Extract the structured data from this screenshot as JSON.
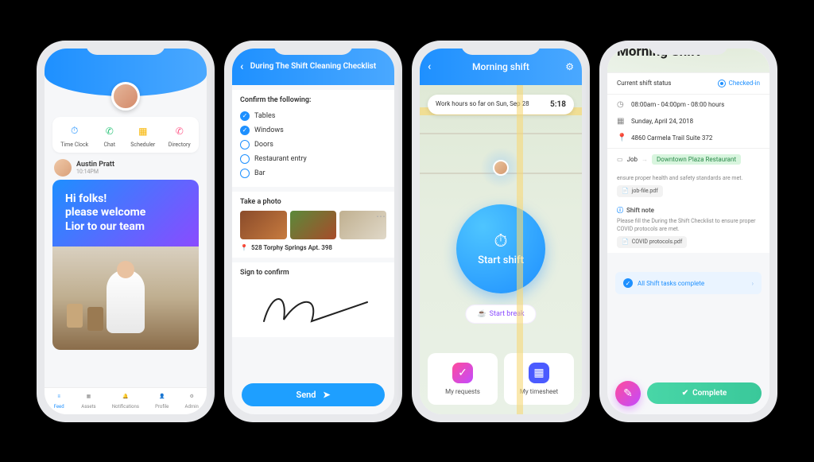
{
  "screen1": {
    "quicklinks": [
      {
        "label": "Time Clock",
        "icon": "⏱",
        "color": "#1e90ff"
      },
      {
        "label": "Chat",
        "icon": "☎",
        "color": "#2cc47a"
      },
      {
        "label": "Scheduler",
        "icon": "📅",
        "color": "#f7b500"
      },
      {
        "label": "Directory",
        "icon": "📞",
        "color": "#ff5b8a"
      }
    ],
    "post": {
      "author": "Austin Pratt",
      "time": "10:14PM",
      "welcome_line1": "Hi folks!",
      "welcome_line2": "please welcome",
      "welcome_line3": "Lior to our team"
    },
    "tabs": [
      {
        "label": "Feed",
        "active": true
      },
      {
        "label": "Assets",
        "active": false
      },
      {
        "label": "Notifications",
        "active": false
      },
      {
        "label": "Profile",
        "active": false
      },
      {
        "label": "Admin",
        "active": false
      }
    ]
  },
  "screen2": {
    "title": "During The Shift Cleaning Checklist",
    "confirm_label": "Confirm the following:",
    "items": [
      {
        "label": "Tables",
        "checked": true
      },
      {
        "label": "Windows",
        "checked": true
      },
      {
        "label": "Doors",
        "checked": false
      },
      {
        "label": "Restaurant entry",
        "checked": false
      },
      {
        "label": "Bar",
        "checked": false
      }
    ],
    "photo_label": "Take a photo",
    "address_label": "528 Torphy Springs Apt. 398",
    "sign_label": "Sign to confirm",
    "send_label": "Send"
  },
  "screen3": {
    "title": "Morning shift",
    "work_hours_label": "Work hours so far on Sun, Sep 28",
    "work_hours_value": "5:18",
    "start_shift_label": "Start shift",
    "start_break_label": "Start break",
    "cards": [
      {
        "label": "My requests",
        "icon": "✓",
        "bg": "linear-gradient(135deg,#ff4b9b,#c24bff)"
      },
      {
        "label": "My timesheet",
        "icon": "▦",
        "bg": "#4b5bff"
      }
    ]
  },
  "screen4": {
    "title": "Morning Shift",
    "status_label": "Current shift status",
    "status_value": "Checked-in",
    "info": {
      "time": "08:00am - 04:00pm - 08:00 hours",
      "date": "Sunday, April 24, 2018",
      "address": "4860 Carmela Trail Suite 372"
    },
    "job_label": "Job",
    "job_value": "Downtown Plaza Restaurant",
    "note1_text": "ensure proper health and safety standards are met.",
    "note1_file": "job-file.pdf",
    "note2_title": "Shift note",
    "note2_text": "Please fill the During the Shift Checklist to ensure proper COVID protocols are met.",
    "note2_file": "COVID protocols.pdf",
    "tasks_label": "All Shift tasks complete",
    "complete_label": "Complete"
  }
}
